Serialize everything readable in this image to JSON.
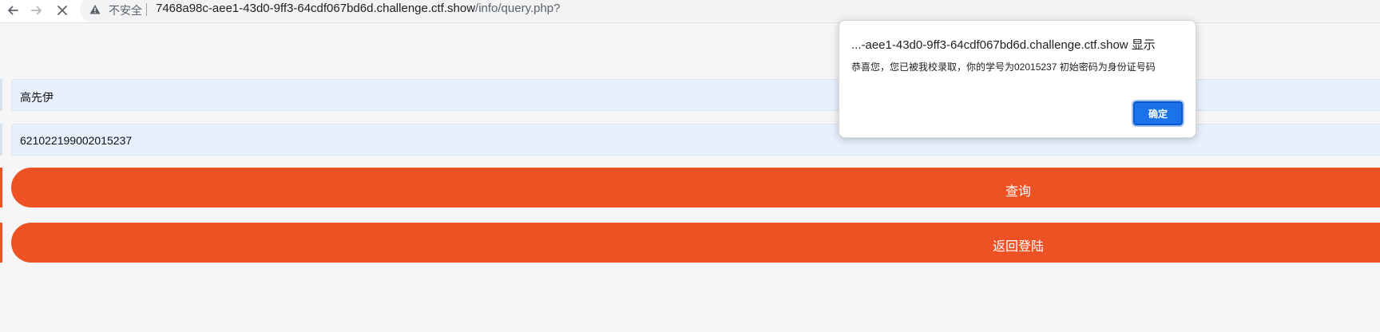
{
  "browser": {
    "security_label": "不安全",
    "url_host": "7468a98c-aee1-43d0-9ff3-64cdf067bd6d.challenge.ctf.show",
    "url_path": "/info/query.php?"
  },
  "form": {
    "name_value": "高先伊",
    "id_value": "621022199002015237",
    "query_button": "查询",
    "back_button": "返回登陆"
  },
  "dialog": {
    "title": "...-aee1-43d0-9ff3-64cdf067bd6d.challenge.ctf.show 显示",
    "message": "恭喜您，您已被我校录取，你的学号为02015237 初始密码为身份证号码",
    "ok_label": "确定"
  },
  "colors": {
    "accent_orange": "#ee5224",
    "dialog_button_blue": "#1a73e8",
    "field_background": "#e8f0fe"
  },
  "icons": {
    "back": "arrow-back-icon",
    "forward": "arrow-forward-icon",
    "stop": "close-icon",
    "security": "warning-triangle-icon"
  }
}
